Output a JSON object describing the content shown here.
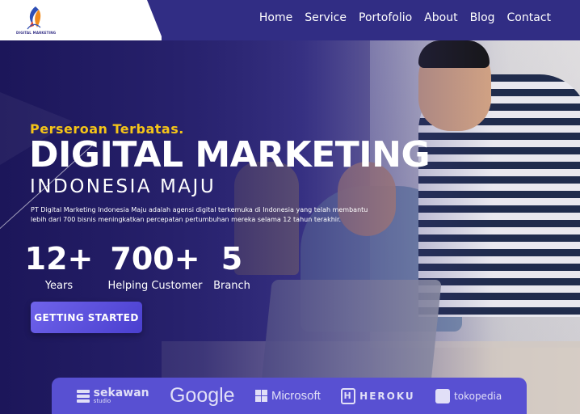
{
  "header": {
    "logo_text": "DIGITAL MARKETING",
    "nav": [
      "Home",
      "Service",
      "Portofolio",
      "About",
      "Blog",
      "Contact"
    ]
  },
  "hero": {
    "tagline": "Perseroan Terbatas.",
    "title": "DIGITAL MARKETING",
    "subtitle": "INDONESIA MAJU",
    "description": "PT Digital Marketing Indonesia Maju adalah agensi digital terkemuka di Indonesia yang telah membantu lebih dari 700 bisnis meningkatkan percepatan pertumbuhan mereka selama 12 tahun terakhir.",
    "stats": [
      {
        "value": "12+",
        "label": "Years"
      },
      {
        "value": "700+",
        "label": "Helping Customer"
      },
      {
        "value": "5",
        "label": "Branch"
      }
    ],
    "cta": "GETTING STARTED"
  },
  "partners": {
    "sekawan": {
      "name": "sekawan",
      "sub": "studio"
    },
    "google": "Google",
    "microsoft": "Microsoft",
    "heroku": "HEROKU",
    "tokopedia": "tokopedia"
  },
  "colors": {
    "header_bg": "#312d84",
    "tagline": "#f5c518",
    "cta": "#5a50dc",
    "partners_bg": "#5850d2"
  }
}
